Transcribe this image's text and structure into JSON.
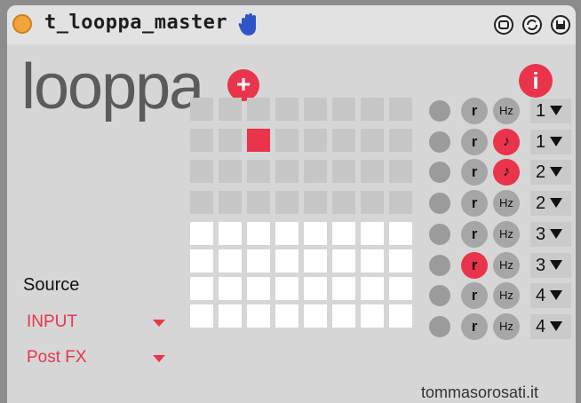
{
  "window": {
    "title": "t_looppa_master",
    "icons": [
      "hand-icon",
      "loop-icon",
      "sync-icon",
      "save-icon"
    ]
  },
  "logo": {
    "text": "looppa",
    "plus": "+"
  },
  "info": {
    "label": "i"
  },
  "grid": {
    "rows": 8,
    "cols": 8,
    "dim_rows": 4,
    "active_cells": [
      [
        1,
        2
      ]
    ]
  },
  "source": {
    "label": "Source",
    "input_value": "INPUT",
    "fx_value": "Post FX"
  },
  "controls": {
    "rows": [
      {
        "r": "r",
        "r_on": false,
        "mode": "Hz",
        "mode_note": false,
        "num": "1"
      },
      {
        "r": "r",
        "r_on": false,
        "mode": "♪",
        "mode_note": true,
        "num": "1"
      },
      {
        "r": "r",
        "r_on": false,
        "mode": "♪",
        "mode_note": true,
        "num": "2"
      },
      {
        "r": "r",
        "r_on": false,
        "mode": "Hz",
        "mode_note": false,
        "num": "2"
      },
      {
        "r": "r",
        "r_on": false,
        "mode": "Hz",
        "mode_note": false,
        "num": "3"
      },
      {
        "r": "r",
        "r_on": true,
        "mode": "Hz",
        "mode_note": false,
        "num": "3"
      },
      {
        "r": "r",
        "r_on": false,
        "mode": "Hz",
        "mode_note": false,
        "num": "4"
      },
      {
        "r": "r",
        "r_on": false,
        "mode": "Hz",
        "mode_note": false,
        "num": "4"
      }
    ]
  },
  "credit": "tommasorosati.it",
  "colors": {
    "accent": "#e9344c",
    "panel": "#d6d6d6",
    "grid_dim": "#c6c6c6",
    "grid_lit": "#ffffff"
  }
}
